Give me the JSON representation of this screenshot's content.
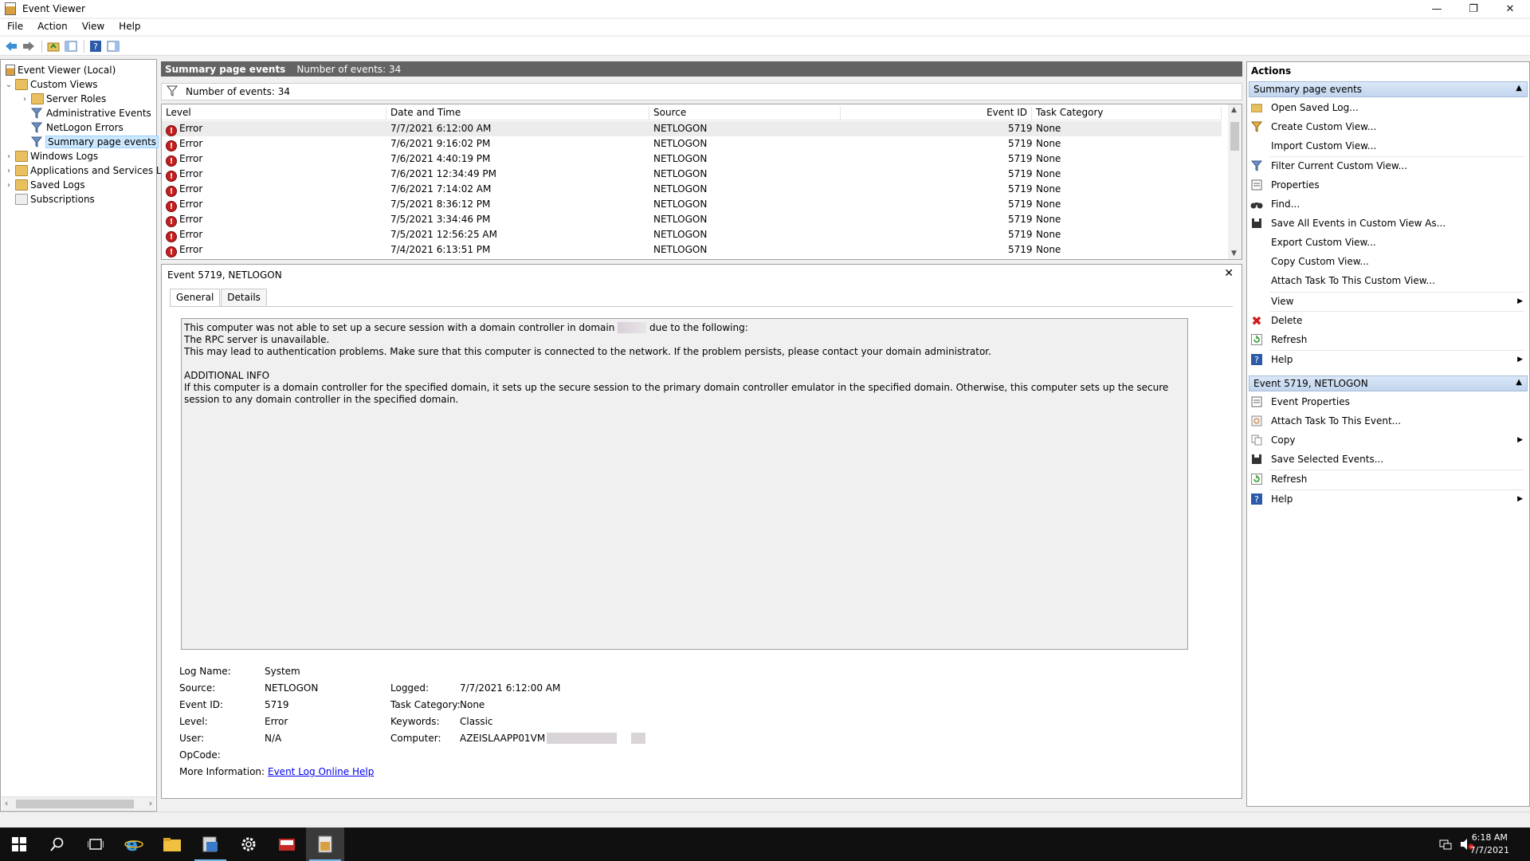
{
  "window": {
    "title": "Event Viewer"
  },
  "menu": [
    "File",
    "Action",
    "View",
    "Help"
  ],
  "tree": {
    "root": "Event Viewer (Local)",
    "custom_views": "Custom Views",
    "server_roles": "Server Roles",
    "admin_events": "Administrative Events",
    "netlogon_errors": "NetLogon Errors",
    "summary_page_events": "Summary page events",
    "windows_logs": "Windows Logs",
    "app_services": "Applications and Services Lo",
    "saved_logs": "Saved Logs",
    "subscriptions": "Subscriptions"
  },
  "middle": {
    "header_title": "Summary page events",
    "header_count": "Number of events: 34",
    "filter_text": "Number of events: 34",
    "columns": [
      "Level",
      "Date and Time",
      "Source",
      "Event ID",
      "Task Category"
    ],
    "rows": [
      {
        "level": "Error",
        "date": "7/7/2021 6:12:00 AM",
        "source": "NETLOGON",
        "id": "5719",
        "category": "None"
      },
      {
        "level": "Error",
        "date": "7/6/2021 9:16:02 PM",
        "source": "NETLOGON",
        "id": "5719",
        "category": "None"
      },
      {
        "level": "Error",
        "date": "7/6/2021 4:40:19 PM",
        "source": "NETLOGON",
        "id": "5719",
        "category": "None"
      },
      {
        "level": "Error",
        "date": "7/6/2021 12:34:49 PM",
        "source": "NETLOGON",
        "id": "5719",
        "category": "None"
      },
      {
        "level": "Error",
        "date": "7/6/2021 7:14:02 AM",
        "source": "NETLOGON",
        "id": "5719",
        "category": "None"
      },
      {
        "level": "Error",
        "date": "7/5/2021 8:36:12 PM",
        "source": "NETLOGON",
        "id": "5719",
        "category": "None"
      },
      {
        "level": "Error",
        "date": "7/5/2021 3:34:46 PM",
        "source": "NETLOGON",
        "id": "5719",
        "category": "None"
      },
      {
        "level": "Error",
        "date": "7/5/2021 12:56:25 AM",
        "source": "NETLOGON",
        "id": "5719",
        "category": "None"
      },
      {
        "level": "Error",
        "date": "7/4/2021 6:13:51 PM",
        "source": "NETLOGON",
        "id": "5719",
        "category": "None"
      }
    ]
  },
  "detail": {
    "title": "Event 5719, NETLOGON",
    "tabs": [
      "General",
      "Details"
    ],
    "msg_line1a": "This computer was not able to set up a secure session with a domain controller in domain",
    "msg_line1b": "due to the following:",
    "msg_line2": "The RPC server is unavailable.",
    "msg_line3": "This may lead to authentication problems. Make sure that this computer is connected to the network. If the problem persists, please contact your domain administrator.",
    "msg_line4": "ADDITIONAL INFO",
    "msg_line5": "If this computer is a domain controller for the specified domain, it sets up the secure session to the primary domain controller emulator in the specified domain. Otherwise, this computer sets up the secure session to any domain controller in the specified domain.",
    "props": {
      "log_name_label": "Log Name:",
      "log_name": "System",
      "source_label": "Source:",
      "source": "NETLOGON",
      "logged_label": "Logged:",
      "logged": "7/7/2021 6:12:00 AM",
      "event_id_label": "Event ID:",
      "event_id": "5719",
      "task_cat_label": "Task Category:",
      "task_cat": "None",
      "level_label": "Level:",
      "level": "Error",
      "keywords_label": "Keywords:",
      "keywords": "Classic",
      "user_label": "User:",
      "user": "N/A",
      "computer_label": "Computer:",
      "computer": "AZEISLAAPP01VM",
      "opcode_label": "OpCode:",
      "more_info_label": "More Information:",
      "more_info_link": "Event Log Online Help"
    }
  },
  "actions": {
    "title": "Actions",
    "section1": "Summary page events",
    "items1": [
      "Open Saved Log...",
      "Create Custom View...",
      "Import Custom View...",
      "Filter Current Custom View...",
      "Properties",
      "Find...",
      "Save All Events in Custom View As...",
      "Export Custom View...",
      "Copy Custom View...",
      "Attach Task To This Custom View...",
      "View",
      "Delete",
      "Refresh",
      "Help"
    ],
    "section2": "Event 5719, NETLOGON",
    "items2": [
      "Event Properties",
      "Attach Task To This Event...",
      "Copy",
      "Save Selected Events...",
      "Refresh",
      "Help"
    ]
  },
  "clock": {
    "time": "6:18 AM",
    "date": "7/7/2021"
  },
  "colors": {
    "error": "#c41e1e",
    "link": "#0000ee",
    "section": "#c2d6ee"
  }
}
